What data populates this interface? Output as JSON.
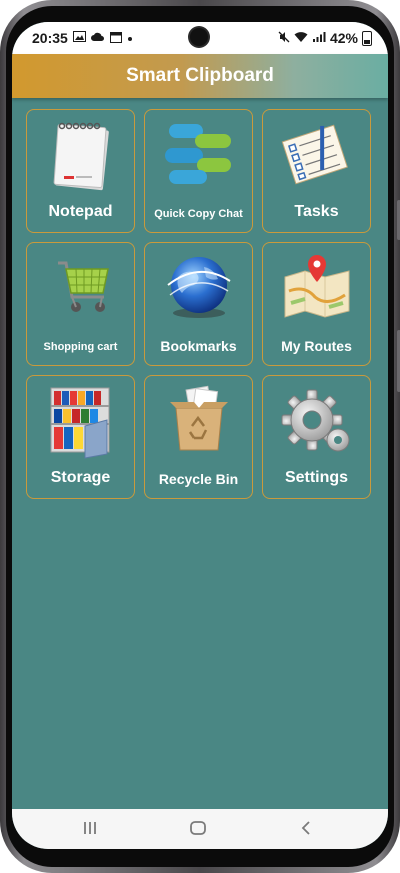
{
  "status": {
    "time": "20:35",
    "battery": "42%"
  },
  "app": {
    "title": "Smart Clipboard"
  },
  "tiles": [
    {
      "label": "Notepad"
    },
    {
      "label": "Quick Copy Chat"
    },
    {
      "label": "Tasks"
    },
    {
      "label": "Shopping cart"
    },
    {
      "label": "Bookmarks"
    },
    {
      "label": "My Routes"
    },
    {
      "label": "Storage"
    },
    {
      "label": "Recycle Bin"
    },
    {
      "label": "Settings"
    }
  ],
  "icons": {
    "status_left": [
      "photo-icon",
      "cloud-icon",
      "calendar-icon",
      "dot-icon"
    ],
    "status_right": [
      "mute-icon",
      "wifi-icon",
      "signal-icon",
      "battery-icon"
    ],
    "tiles": [
      "notepad-icon",
      "chat-bubbles-icon",
      "checklist-icon",
      "shopping-cart-icon",
      "globe-icon",
      "map-pin-icon",
      "shelves-icon",
      "recycle-box-icon",
      "gear-icon"
    ],
    "nav": [
      "recents-icon",
      "home-icon",
      "back-icon"
    ]
  },
  "colors": {
    "tile_border": "#c99a3c",
    "background": "#4a8784",
    "appbar_start": "#d2992e",
    "appbar_end": "#6aaea2"
  }
}
